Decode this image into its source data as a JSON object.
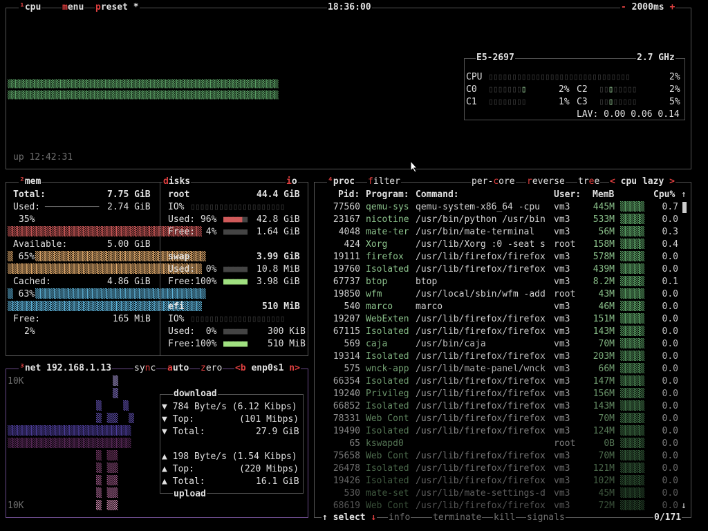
{
  "cpu_box": {
    "title_num": "¹",
    "title": "cpu",
    "menu": "menu",
    "preset": "preset *",
    "time": "18:36:00",
    "minus": "-",
    "interval": "2000ms",
    "plus": "+",
    "uptime": "up 12:42:31",
    "model": "E5-2697",
    "freq": "2.7 GHz",
    "total_label": "CPU",
    "total_pct": "2%",
    "cores": [
      {
        "label": "C0",
        "pct": "2%"
      },
      {
        "label": "C1",
        "pct": "1%"
      },
      {
        "label": "C2",
        "pct": "2%"
      },
      {
        "label": "C3",
        "pct": "5%"
      }
    ],
    "lav": "LAV: 0.00 0.06 0.14"
  },
  "mem_box": {
    "title_num": "²",
    "title": "mem",
    "total_label": "Total:",
    "total_val": "7.75 GiB",
    "used_label": "Used:",
    "used_val": "2.74 GiB",
    "used_pct": "35%",
    "avail_label": "Available:",
    "avail_val": "5.00 GiB",
    "avail_pct": "65%",
    "cached_label": "Cached:",
    "cached_val": "4.86 GiB",
    "cached_pct": "63%",
    "free_label": "Free:",
    "free_val": "165 MiB",
    "free_pct": "2%",
    "colors": {
      "used": "#d05a5a",
      "avail": "#e8b070",
      "cached": "#60b8e0"
    }
  },
  "disks_box": {
    "title": "disks",
    "io": "io",
    "root": {
      "name": "root",
      "size": "44.4 GiB",
      "io": "IO%",
      "used_label": "Used:",
      "used_pct": "96%",
      "used_val": "42.8 GiB",
      "free_label": "Free:",
      "free_pct": "4%",
      "free_val": "1.64 GiB"
    },
    "swap": {
      "name": "swap",
      "size": "3.99 GiB",
      "used_label": "Used:",
      "used_pct": "0%",
      "used_val": "10.8 MiB",
      "free_label": "Free:",
      "free_pct": "100%",
      "free_val": "3.98 GiB"
    },
    "efi": {
      "name": "efi",
      "size": "510 MiB",
      "io": "IO%",
      "used_label": "Used:",
      "used_pct": "0%",
      "used_val": "300 KiB",
      "free_label": "Free:",
      "free_pct": "100%",
      "free_val": "510 MiB"
    }
  },
  "net_box": {
    "title_num": "³",
    "title": "net",
    "ip": "192.168.1.13",
    "sync": "sync",
    "auto": "auto",
    "zero": "zero",
    "prev": "<b",
    "iface": "enp0s1",
    "next": "n>",
    "scale_top": "10K",
    "scale_bottom": "10K",
    "download": {
      "title": "download",
      "rate": "784 Byte/s",
      "rate_bits": "(6.12 Kibps)",
      "top_label": "Top:",
      "top_val": "(101 Mibps)",
      "total_label": "Total:",
      "total_val": "27.9 GiB"
    },
    "upload": {
      "title": "upload",
      "rate": "198 Byte/s",
      "rate_bits": "(1.54 Kibps)",
      "top_label": "Top:",
      "top_val": "(220 Mibps)",
      "total_label": "Total:",
      "total_val": "16.1 GiB"
    }
  },
  "proc_box": {
    "title_num": "⁴",
    "title": "proc",
    "filter": "filter",
    "per_core": "per-core",
    "reverse": "reverse",
    "tree": "tree",
    "sort_prev": "<",
    "sort": "cpu lazy",
    "sort_next": ">",
    "headers": {
      "pid": "Pid:",
      "program": "Program:",
      "command": "Command:",
      "user": "User:",
      "mem": "MemB",
      "cpu": "Cpu%"
    },
    "rows": [
      {
        "pid": "77560",
        "program": "qemu-sys",
        "command": "qemu-system-x86_64 -cpu",
        "user": "vm3",
        "mem": "445M",
        "cpu": "0.7"
      },
      {
        "pid": "23167",
        "program": "nicotine",
        "command": "/usr/bin/python /usr/bin",
        "user": "vm3",
        "mem": "533M",
        "cpu": "0.0"
      },
      {
        "pid": "4048",
        "program": "mate-ter",
        "command": "/usr/bin/mate-terminal",
        "user": "vm3",
        "mem": "56M",
        "cpu": "0.3"
      },
      {
        "pid": "424",
        "program": "Xorg",
        "command": "/usr/lib/Xorg :0 -seat s",
        "user": "root",
        "mem": "158M",
        "cpu": "0.4"
      },
      {
        "pid": "19111",
        "program": "firefox",
        "command": "/usr/lib/firefox/firefox",
        "user": "vm3",
        "mem": "578M",
        "cpu": "0.0"
      },
      {
        "pid": "19760",
        "program": "Isolated",
        "command": "/usr/lib/firefox/firefox",
        "user": "vm3",
        "mem": "439M",
        "cpu": "0.0"
      },
      {
        "pid": "67737",
        "program": "btop",
        "command": "btop",
        "user": "vm3",
        "mem": "8.2M",
        "cpu": "0.1"
      },
      {
        "pid": "19850",
        "program": "wfm",
        "command": "/usr/local/sbin/wfm -add",
        "user": "root",
        "mem": "43M",
        "cpu": "0.0"
      },
      {
        "pid": "540",
        "program": "marco",
        "command": "marco",
        "user": "vm3",
        "mem": "46M",
        "cpu": "0.0"
      },
      {
        "pid": "19207",
        "program": "WebExten",
        "command": "/usr/lib/firefox/firefox",
        "user": "vm3",
        "mem": "151M",
        "cpu": "0.0"
      },
      {
        "pid": "67115",
        "program": "Isolated",
        "command": "/usr/lib/firefox/firefox",
        "user": "vm3",
        "mem": "143M",
        "cpu": "0.0"
      },
      {
        "pid": "569",
        "program": "caja",
        "command": "/usr/bin/caja",
        "user": "vm3",
        "mem": "70M",
        "cpu": "0.0"
      },
      {
        "pid": "19314",
        "program": "Isolated",
        "command": "/usr/lib/firefox/firefox",
        "user": "vm3",
        "mem": "203M",
        "cpu": "0.0"
      },
      {
        "pid": "575",
        "program": "wnck-app",
        "command": "/usr/lib/mate-panel/wnck",
        "user": "vm3",
        "mem": "66M",
        "cpu": "0.0"
      },
      {
        "pid": "66354",
        "program": "Isolated",
        "command": "/usr/lib/firefox/firefox",
        "user": "vm3",
        "mem": "147M",
        "cpu": "0.0"
      },
      {
        "pid": "19240",
        "program": "Privileg",
        "command": "/usr/lib/firefox/firefox",
        "user": "vm3",
        "mem": "156M",
        "cpu": "0.0"
      },
      {
        "pid": "66852",
        "program": "Isolated",
        "command": "/usr/lib/firefox/firefox",
        "user": "vm3",
        "mem": "143M",
        "cpu": "0.0"
      },
      {
        "pid": "78331",
        "program": "Web Cont",
        "command": "/usr/lib/firefox/firefox",
        "user": "vm3",
        "mem": "70M",
        "cpu": "0.0"
      },
      {
        "pid": "19490",
        "program": "Isolated",
        "command": "/usr/lib/firefox/firefox",
        "user": "vm3",
        "mem": "124M",
        "cpu": "0.0"
      },
      {
        "pid": "65",
        "program": "kswapd0",
        "command": "",
        "user": "root",
        "mem": "0B",
        "cpu": "0.0"
      },
      {
        "pid": "75658",
        "program": "Web Cont",
        "command": "/usr/lib/firefox/firefox",
        "user": "vm3",
        "mem": "70M",
        "cpu": "0.0"
      },
      {
        "pid": "26478",
        "program": "Isolated",
        "command": "/usr/lib/firefox/firefox",
        "user": "vm3",
        "mem": "121M",
        "cpu": "0.0"
      },
      {
        "pid": "19426",
        "program": "Isolated",
        "command": "/usr/lib/firefox/firefox",
        "user": "vm3",
        "mem": "102M",
        "cpu": "0.0"
      },
      {
        "pid": "530",
        "program": "mate-set",
        "command": "/usr/lib/mate-settings-d",
        "user": "vm3",
        "mem": "45M",
        "cpu": "0.0"
      },
      {
        "pid": "68619",
        "program": "Web Cont",
        "command": "/usr/lib/firefox/firefox",
        "user": "vm3",
        "mem": "72M",
        "cpu": "0.0"
      }
    ],
    "footer": {
      "up": "↑",
      "select": "select",
      "down": "↓",
      "info": "info",
      "terminate": "terminate",
      "kill": "kill",
      "signals": "signals",
      "count": "0/171"
    }
  }
}
